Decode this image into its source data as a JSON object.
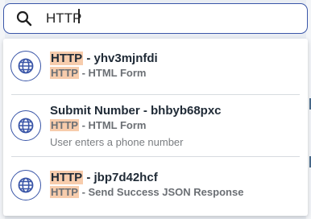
{
  "search": {
    "value": "HTTP",
    "placeholder": ""
  },
  "results": [
    {
      "highlight": "HTTP",
      "title_rest": " - yhv3mjnfdi",
      "sub_highlight": "HTTP",
      "sub_rest": " - HTML Form",
      "description": ""
    },
    {
      "title": "Submit Number - bhbyb68pxc",
      "sub_highlight": "HTTP",
      "sub_rest": " - HTML Form",
      "description": "User enters a phone number"
    },
    {
      "highlight": "HTTP",
      "title_rest": " - jbp7d42hcf",
      "sub_highlight": "HTTP",
      "sub_rest": " - Send Success JSON Response",
      "description": ""
    }
  ],
  "icons": {
    "search": "search-icon",
    "result": "globe-icon"
  },
  "colors": {
    "accent": "#3a56a8",
    "highlight": "#f7ccac",
    "title": "#1f2a36",
    "subtitle": "#6b6f74"
  }
}
